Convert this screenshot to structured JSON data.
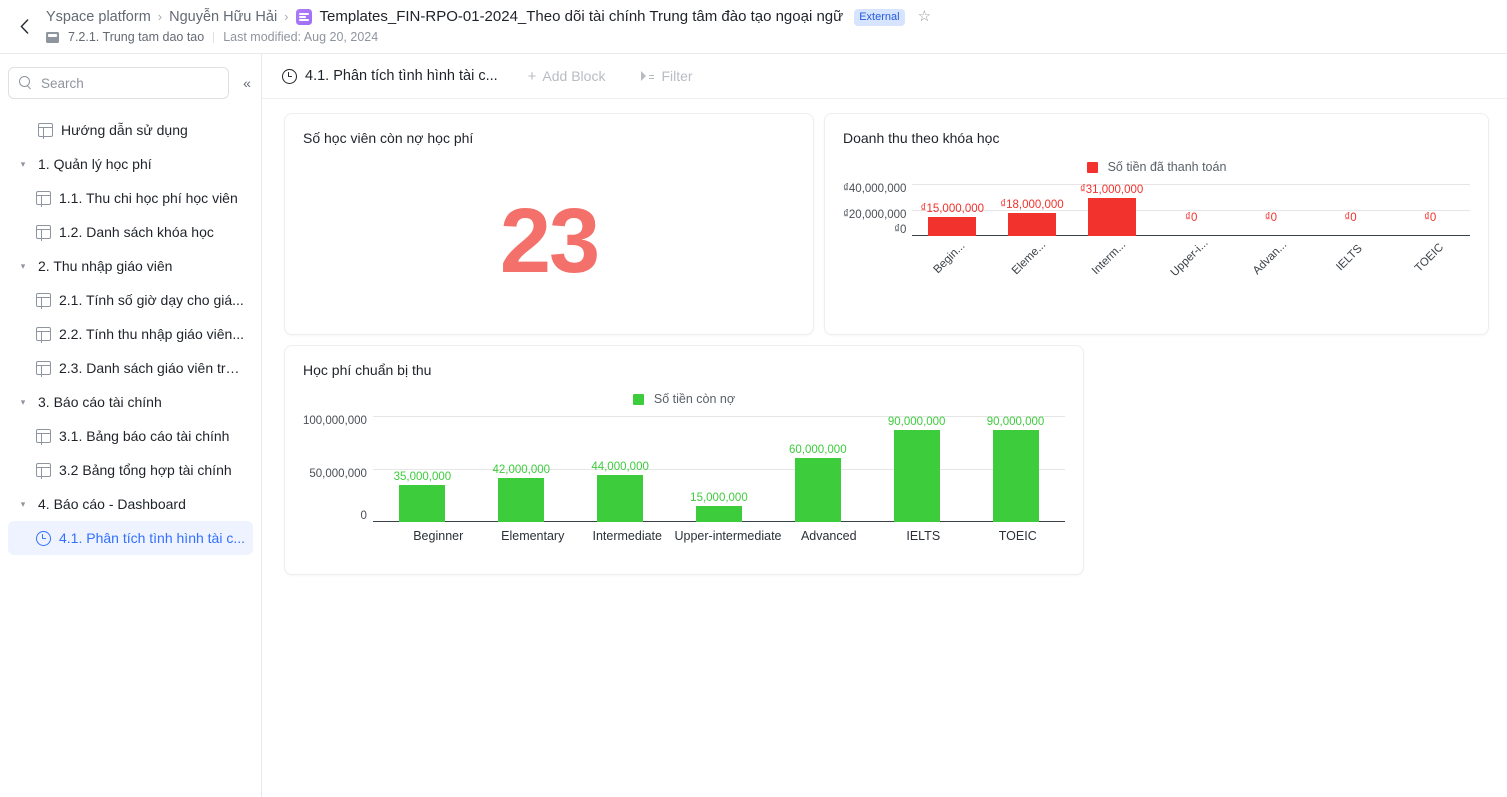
{
  "topbar": {
    "back_icon": "chevron-left-icon",
    "breadcrumbs": [
      {
        "label": "Yspace platform"
      },
      {
        "label": "Nguyễn Hữu Hải"
      }
    ],
    "separator": "›",
    "doc_title": "Templates_FIN-RPO-01-2024_Theo dõi tài chính Trung tâm đào tạo ngoại ngữ",
    "external_badge": "External",
    "star_glyph": "☆",
    "folder_name": "7.2.1. Trung tam dao tao",
    "last_modified": "Last modified: Aug 20, 2024"
  },
  "sidebar": {
    "search": {
      "placeholder": "Search",
      "value": ""
    },
    "collapse_glyph": "«",
    "items": [
      {
        "label": "Hướng dẫn sử dụng",
        "level": 1,
        "icon": "sheet-icon",
        "expandable": false,
        "selected": false
      },
      {
        "label": "1. Quản lý học phí",
        "level": 1,
        "icon": "caret",
        "expandable": true,
        "selected": false
      },
      {
        "label": "1.1. Thu chi học phí học viên",
        "level": 2,
        "icon": "sheet-icon",
        "expandable": false,
        "selected": false
      },
      {
        "label": "1.2. Danh sách khóa học",
        "level": 2,
        "icon": "sheet-icon",
        "expandable": false,
        "selected": false
      },
      {
        "label": "2. Thu nhập giáo viên",
        "level": 1,
        "icon": "caret",
        "expandable": true,
        "selected": false
      },
      {
        "label": "2.1. Tính số giờ dạy cho giá...",
        "level": 2,
        "icon": "sheet-icon",
        "expandable": false,
        "selected": false
      },
      {
        "label": "2.2. Tính thu nhập giáo viên...",
        "level": 2,
        "icon": "sheet-icon",
        "expandable": false,
        "selected": false
      },
      {
        "label": "2.3. Danh sách giáo viên trợ...",
        "level": 2,
        "icon": "sheet-icon",
        "expandable": false,
        "selected": false
      },
      {
        "label": "3. Báo cáo tài chính",
        "level": 1,
        "icon": "caret",
        "expandable": true,
        "selected": false
      },
      {
        "label": "3.1. Bảng báo cáo tài chính",
        "level": 2,
        "icon": "sheet-icon",
        "expandable": false,
        "selected": false
      },
      {
        "label": "3.2 Bảng tổng hợp tài chính",
        "level": 2,
        "icon": "sheet-icon",
        "expandable": false,
        "selected": false
      },
      {
        "label": "4. Báo cáo - Dashboard",
        "level": 1,
        "icon": "caret",
        "expandable": true,
        "selected": false
      },
      {
        "label": "4.1. Phân tích tình hình tài c...",
        "level": 2,
        "icon": "clock-icon",
        "expandable": false,
        "selected": true
      }
    ]
  },
  "toolbar": {
    "page_title": "4.1. Phân tích tình hình tài c...",
    "add_block_label": "Add Block",
    "add_block_glyph": "+",
    "filter_label": "Filter"
  },
  "cards": {
    "kpi": {
      "title": "Số học viên còn nợ học phí",
      "value": "23",
      "color": "#f4706a"
    },
    "revenue": {
      "title": "Doanh thu theo khóa học"
    },
    "debt": {
      "title": "Học phí chuẩn bị thu"
    }
  },
  "chart_data": [
    {
      "id": "revenue",
      "type": "bar",
      "title": "Doanh thu theo khóa học",
      "categories": [
        "Begin...",
        "Eleme...",
        "Interm...",
        "Upper-i...",
        "Advan...",
        "IELTS",
        "TOEIC"
      ],
      "categories_full": [
        "Beginner",
        "Elementary",
        "Intermediate",
        "Upper-intermediate",
        "Advanced",
        "IELTS",
        "TOEIC"
      ],
      "series": [
        {
          "name": "Số tiền đã thanh toán",
          "color": "#f2322c",
          "values": [
            15000000,
            18000000,
            31000000,
            0,
            0,
            0,
            0
          ],
          "value_labels": [
            "₫15,000,000",
            "₫18,000,000",
            "₫31,000,000",
            "₫0",
            "₫0",
            "₫0",
            "₫0"
          ]
        }
      ],
      "ylim": [
        0,
        40000000
      ],
      "yticks": [
        40000000,
        20000000,
        0
      ],
      "ytick_labels": [
        "₫40,000,000",
        "₫20,000,000",
        "₫0"
      ],
      "xlabel": "",
      "ylabel": "",
      "grid": true,
      "legend_position": "top-center",
      "xtick_rotation": -45
    },
    {
      "id": "debt",
      "type": "bar",
      "title": "Học phí chuẩn bị thu",
      "categories": [
        "Beginner",
        "Elementary",
        "Intermediate",
        "Upper-intermediate",
        "Advanced",
        "IELTS",
        "TOEIC"
      ],
      "series": [
        {
          "name": "Số tiền còn nợ",
          "color": "#3dcc3c",
          "values": [
            35000000,
            42000000,
            44000000,
            15000000,
            60000000,
            90000000,
            90000000
          ],
          "value_labels": [
            "35,000,000",
            "42,000,000",
            "44,000,000",
            "15,000,000",
            "60,000,000",
            "90,000,000",
            "90,000,000"
          ]
        }
      ],
      "ylim": [
        0,
        100000000
      ],
      "yticks": [
        100000000,
        50000000,
        0
      ],
      "ytick_labels": [
        "100,000,000",
        "50,000,000",
        "0"
      ],
      "xlabel": "",
      "ylabel": "",
      "grid": true,
      "legend_position": "top-center",
      "xtick_rotation": 0
    }
  ]
}
